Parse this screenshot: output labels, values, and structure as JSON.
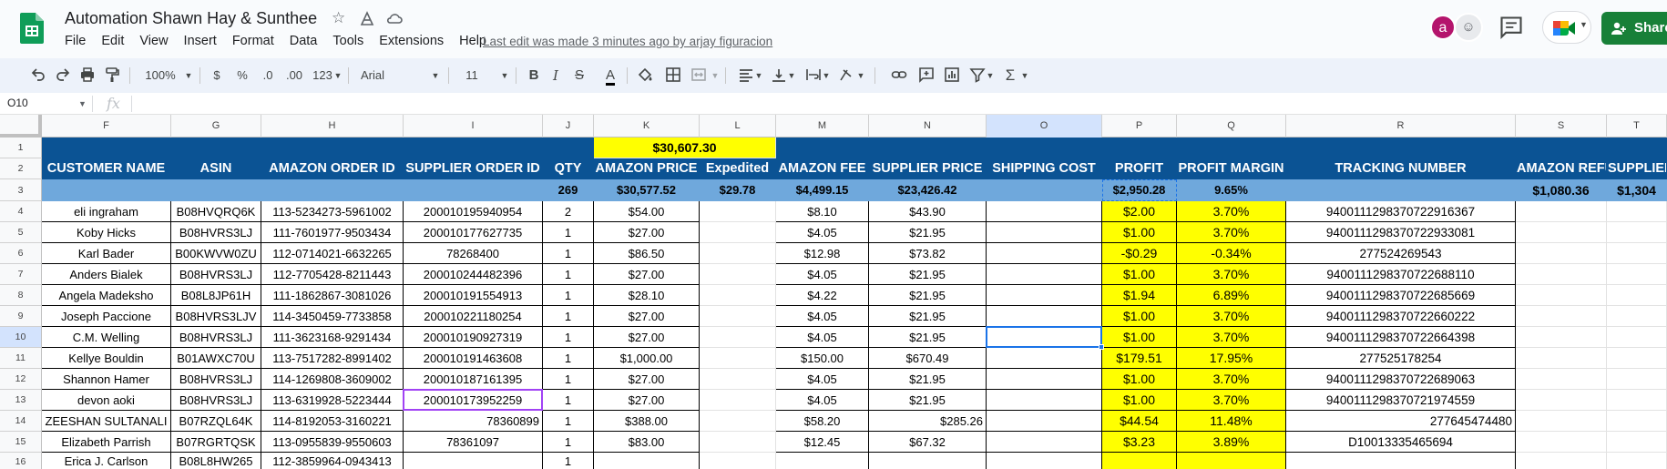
{
  "app": {
    "title": "Automation Shawn Hay & Sunthee",
    "menu": [
      "File",
      "Edit",
      "View",
      "Insert",
      "Format",
      "Data",
      "Tools",
      "Extensions",
      "Help"
    ],
    "last_edit": "Last edit was made 3 minutes ago by arjay figuracion",
    "avatar_letter": "a",
    "share_label": "Share",
    "accent_green": "#188038",
    "header_blue": "#0b5394",
    "totals_blue": "#6fa8dc",
    "highlight_yellow": "#ffff00"
  },
  "toolbar": {
    "zoom": "100%",
    "currency": "$",
    "percent": "%",
    "dec_decrease": ".0",
    "dec_increase": ".00",
    "number_format": "123",
    "font": "Arial",
    "font_size": "11",
    "icons": [
      "undo-icon",
      "redo-icon",
      "print-icon",
      "paint-format-icon",
      "bold-icon",
      "italic-icon",
      "strikethrough-icon",
      "text-color-icon",
      "fill-color-icon",
      "borders-icon",
      "merge-icon",
      "align-icon",
      "valign-icon",
      "wrap-icon",
      "rotate-icon",
      "link-icon",
      "comment-icon",
      "chart-icon",
      "filter-icon",
      "functions-icon"
    ]
  },
  "formula_bar": {
    "cell_ref": "O10",
    "fx_label": "fx",
    "content": ""
  },
  "sheet": {
    "columns": [
      "F",
      "G",
      "H",
      "I",
      "J",
      "K",
      "L",
      "M",
      "N",
      "O",
      "P",
      "Q",
      "R",
      "S",
      "T"
    ],
    "selected_column": "O",
    "selected_row": "10",
    "row_numbers": [
      "1",
      "2",
      "3",
      "4",
      "5",
      "6",
      "7",
      "8",
      "9",
      "10",
      "11",
      "12",
      "13",
      "14",
      "15",
      "16"
    ],
    "row1_total": "$30,607.30",
    "headers": [
      "CUSTOMER NAME",
      "ASIN",
      "AMAZON ORDER ID",
      "SUPPLIER ORDER ID",
      "QTY",
      "AMAZON PRICE",
      "Expedited",
      "AMAZON FEE",
      "SUPPLIER PRICE",
      "SHIPPING COST",
      "PROFIT",
      "PROFIT MARGIN",
      "TRACKING NUMBER",
      "AMAZON REFUND",
      "SUPPLIER REFUND"
    ],
    "totals": [
      "",
      "",
      "",
      "",
      "269",
      "$30,577.52",
      "$29.78",
      "$4,499.15",
      "$23,426.42",
      "",
      "$2,950.28",
      "9.65%",
      "",
      "$1,080.36",
      "$1,304"
    ],
    "rows": [
      [
        "eli ingraham",
        "B08HVQRQ6K",
        "113-5234273-5961002",
        "200010195940954",
        "2",
        "$54.00",
        "",
        "$8.10",
        "$43.90",
        "",
        "$2.00",
        "3.70%",
        "9400111298370722916367",
        "",
        ""
      ],
      [
        "Koby Hicks",
        "B08HVRS3LJ",
        "111-7601977-9503434",
        "200010177627735",
        "1",
        "$27.00",
        "",
        "$4.05",
        "$21.95",
        "",
        "$1.00",
        "3.70%",
        "9400111298370722933081",
        "",
        ""
      ],
      [
        "Karl Bader",
        "B00KWVW0ZU",
        "112-0714021-6632265",
        "78268400",
        "1",
        "$86.50",
        "",
        "$12.98",
        "$73.82",
        "",
        "-$0.29",
        "-0.34%",
        "277524269543",
        "",
        ""
      ],
      [
        "Anders Bialek",
        "B08HVRS3LJ",
        "112-7705428-8211443",
        "200010244482396",
        "1",
        "$27.00",
        "",
        "$4.05",
        "$21.95",
        "",
        "$1.00",
        "3.70%",
        "9400111298370722688110",
        "",
        ""
      ],
      [
        "Angela Madeksho",
        "B08L8JP61H",
        "111-1862867-3081026",
        "200010191554913",
        "1",
        "$28.10",
        "",
        "$4.22",
        "$21.95",
        "",
        "$1.94",
        "6.89%",
        "9400111298370722685669",
        "",
        ""
      ],
      [
        "Joseph Paccione",
        "B08HVRS3LJV",
        "114-3450459-7733858",
        "200010221180254",
        "1",
        "$27.00",
        "",
        "$4.05",
        "$21.95",
        "",
        "$1.00",
        "3.70%",
        "9400111298370722660222",
        "",
        ""
      ],
      [
        "C.M. Welling",
        "B08HVRS3LJ",
        "111-3623168-9291434",
        "200010190927319",
        "1",
        "$27.00",
        "",
        "$4.05",
        "$21.95",
        "",
        "$1.00",
        "3.70%",
        "9400111298370722664398",
        "",
        ""
      ],
      [
        "Kellye Bouldin",
        "B01AWXC70U",
        "113-7517282-8991402",
        "200010191463608",
        "1",
        "$1,000.00",
        "",
        "$150.00",
        "$670.49",
        "",
        "$179.51",
        "17.95%",
        "277525178254",
        "",
        ""
      ],
      [
        "Shannon Hamer",
        "B08HVRS3LJ",
        "114-1269808-3609002",
        "200010187161395",
        "1",
        "$27.00",
        "",
        "$4.05",
        "$21.95",
        "",
        "$1.00",
        "3.70%",
        "9400111298370722689063",
        "",
        ""
      ],
      [
        "devon aoki",
        "B08HVRS3LJ",
        "113-6319928-5223444",
        "200010173952259",
        "1",
        "$27.00",
        "",
        "$4.05",
        "$21.95",
        "",
        "$1.00",
        "3.70%",
        "9400111298370721974559",
        "",
        ""
      ],
      [
        "ZEESHAN SULTANALI",
        "B07RZQL64K",
        "114-8192053-3160221",
        "78360899",
        "1",
        "$388.00",
        "",
        "$58.20",
        "$285.26",
        "",
        "$44.54",
        "11.48%",
        "277645474480",
        "",
        ""
      ],
      [
        "Elizabeth Parrish",
        "B07RGRTQSK",
        "113-0955839-9550603",
        "78361097",
        "1",
        "$83.00",
        "",
        "$12.45",
        "$67.32",
        "",
        "$3.23",
        "3.89%",
        "D10013335465694",
        "",
        ""
      ],
      [
        "Erica J. Carlson",
        "B08L8HW265",
        "112-3859964-0943413",
        "",
        "1",
        "",
        "",
        "",
        "",
        "",
        "",
        "",
        "",
        "",
        ""
      ]
    ]
  }
}
